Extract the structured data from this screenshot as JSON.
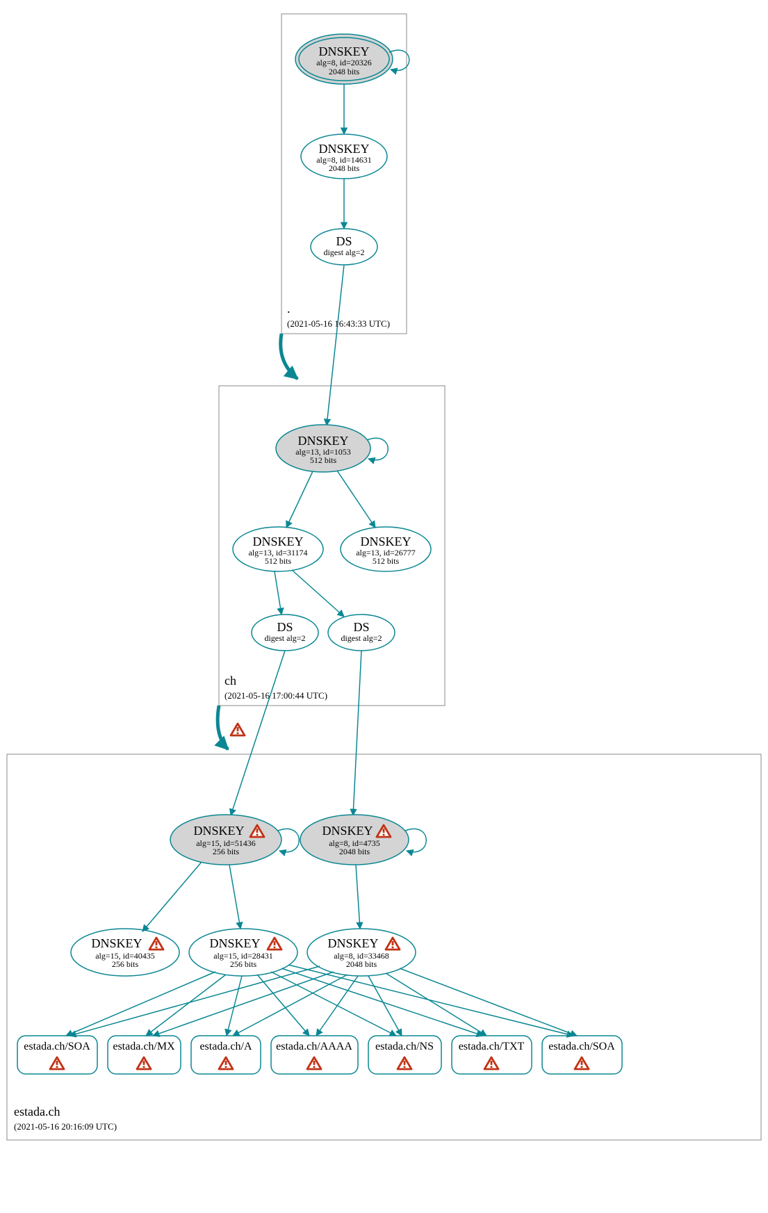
{
  "zones": {
    "root": {
      "name": ".",
      "timestamp": "(2021-05-16 16:43:33 UTC)"
    },
    "ch": {
      "name": "ch",
      "timestamp": "(2021-05-16 17:00:44 UTC)"
    },
    "estada": {
      "name": "estada.ch",
      "timestamp": "(2021-05-16 20:16:09 UTC)"
    }
  },
  "nodes": {
    "root_ksk": {
      "title": "DNSKEY",
      "l1": "alg=8, id=20326",
      "l2": "2048 bits",
      "warn": false
    },
    "root_zsk": {
      "title": "DNSKEY",
      "l1": "alg=8, id=14631",
      "l2": "2048 bits",
      "warn": false
    },
    "root_ds": {
      "title": "DS",
      "l1": "digest alg=2",
      "l2": "",
      "warn": false
    },
    "ch_ksk": {
      "title": "DNSKEY",
      "l1": "alg=13, id=1053",
      "l2": "512 bits",
      "warn": false
    },
    "ch_zsk1": {
      "title": "DNSKEY",
      "l1": "alg=13, id=31174",
      "l2": "512 bits",
      "warn": false
    },
    "ch_zsk2": {
      "title": "DNSKEY",
      "l1": "alg=13, id=26777",
      "l2": "512 bits",
      "warn": false
    },
    "ch_ds1": {
      "title": "DS",
      "l1": "digest alg=2",
      "l2": "",
      "warn": false
    },
    "ch_ds2": {
      "title": "DS",
      "l1": "digest alg=2",
      "l2": "",
      "warn": false
    },
    "est_ksk1": {
      "title": "DNSKEY",
      "l1": "alg=15, id=51436",
      "l2": "256 bits",
      "warn": true
    },
    "est_ksk2": {
      "title": "DNSKEY",
      "l1": "alg=8, id=4735",
      "l2": "2048 bits",
      "warn": true
    },
    "est_zsk1": {
      "title": "DNSKEY",
      "l1": "alg=15, id=40435",
      "l2": "256 bits",
      "warn": true
    },
    "est_zsk2": {
      "title": "DNSKEY",
      "l1": "alg=15, id=28431",
      "l2": "256 bits",
      "warn": true
    },
    "est_zsk3": {
      "title": "DNSKEY",
      "l1": "alg=8, id=33468",
      "l2": "2048 bits",
      "warn": true
    }
  },
  "rrsets": {
    "r1": "estada.ch/SOA",
    "r2": "estada.ch/MX",
    "r3": "estada.ch/A",
    "r4": "estada.ch/AAAA",
    "r5": "estada.ch/NS",
    "r6": "estada.ch/TXT",
    "r7": "estada.ch/SOA"
  },
  "colors": {
    "stroke": "#0b8793",
    "warn": "#c13316"
  }
}
